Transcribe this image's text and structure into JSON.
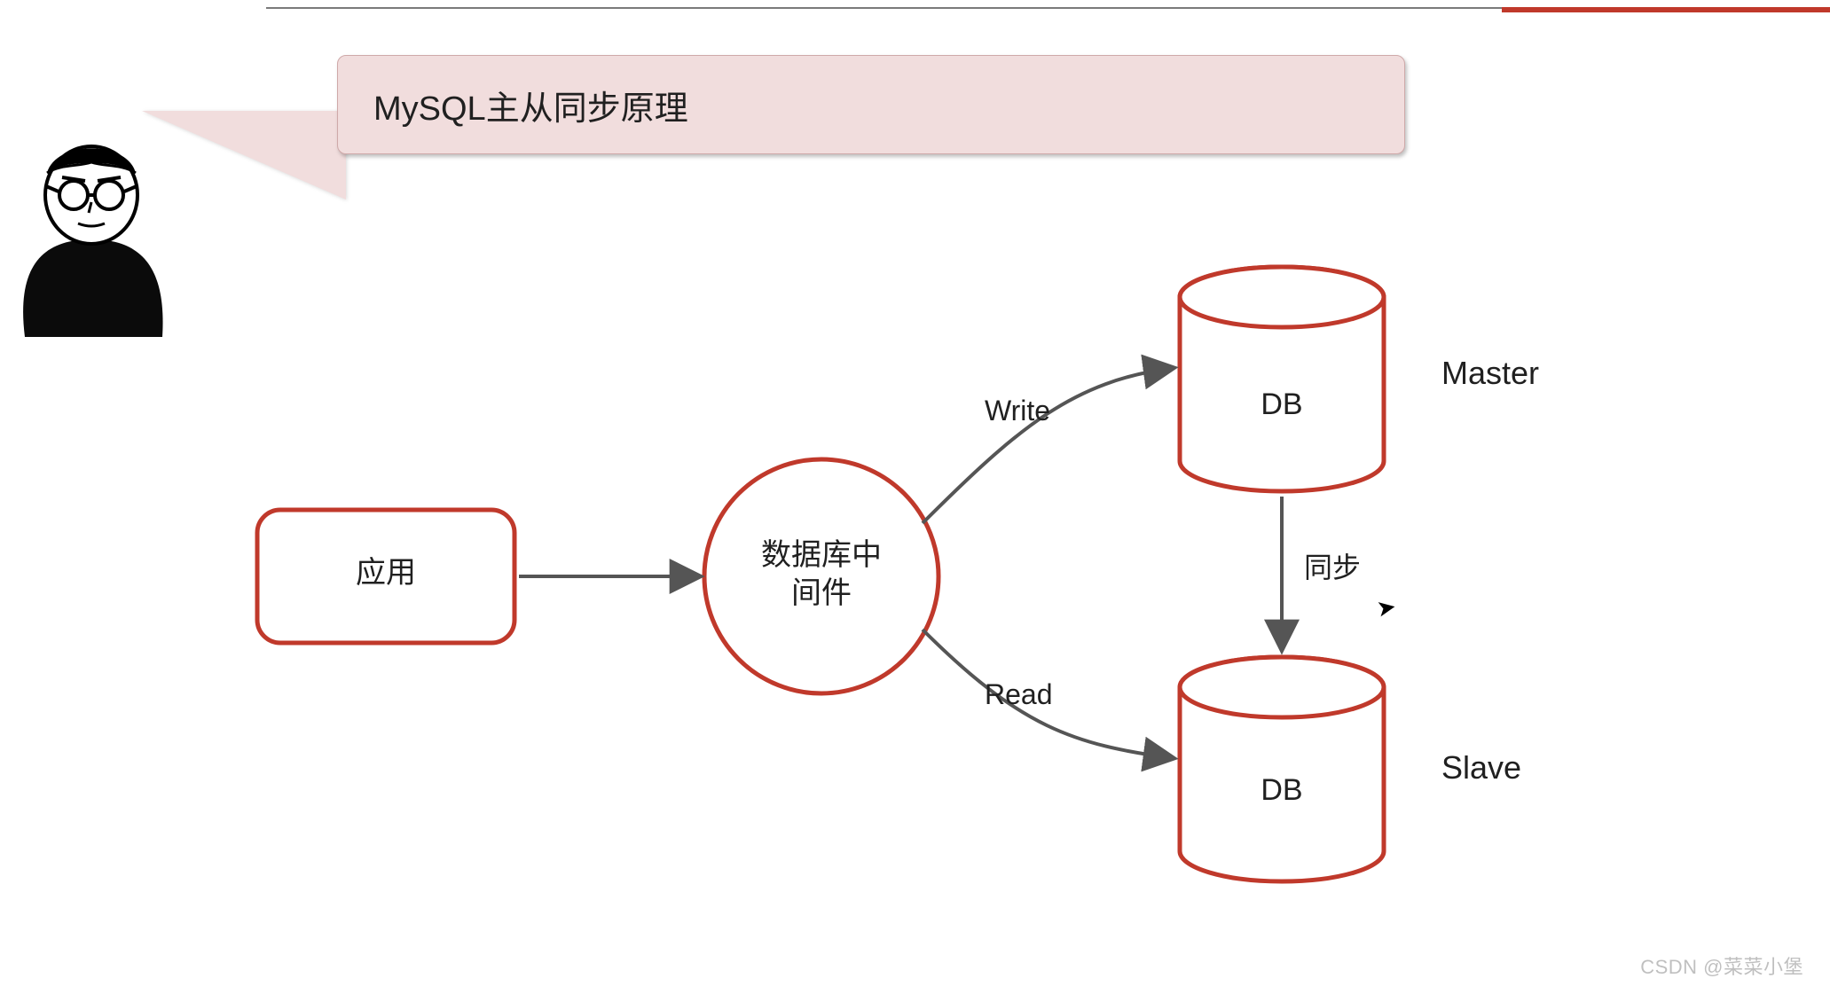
{
  "title": "MySQL主从同步原理",
  "nodes": {
    "app": {
      "label": "应用"
    },
    "middleware": {
      "label": "数据库中\n间件"
    },
    "master_db": {
      "label": "DB"
    },
    "slave_db": {
      "label": "DB"
    }
  },
  "edges": {
    "write": {
      "label": "Write"
    },
    "read": {
      "label": "Read"
    },
    "sync": {
      "label": "同步"
    }
  },
  "role_labels": {
    "master": "Master",
    "slave": "Slave"
  },
  "watermark": "CSDN @菜菜小堡",
  "colors": {
    "accent": "#c0392b",
    "stroke": "#555555"
  }
}
